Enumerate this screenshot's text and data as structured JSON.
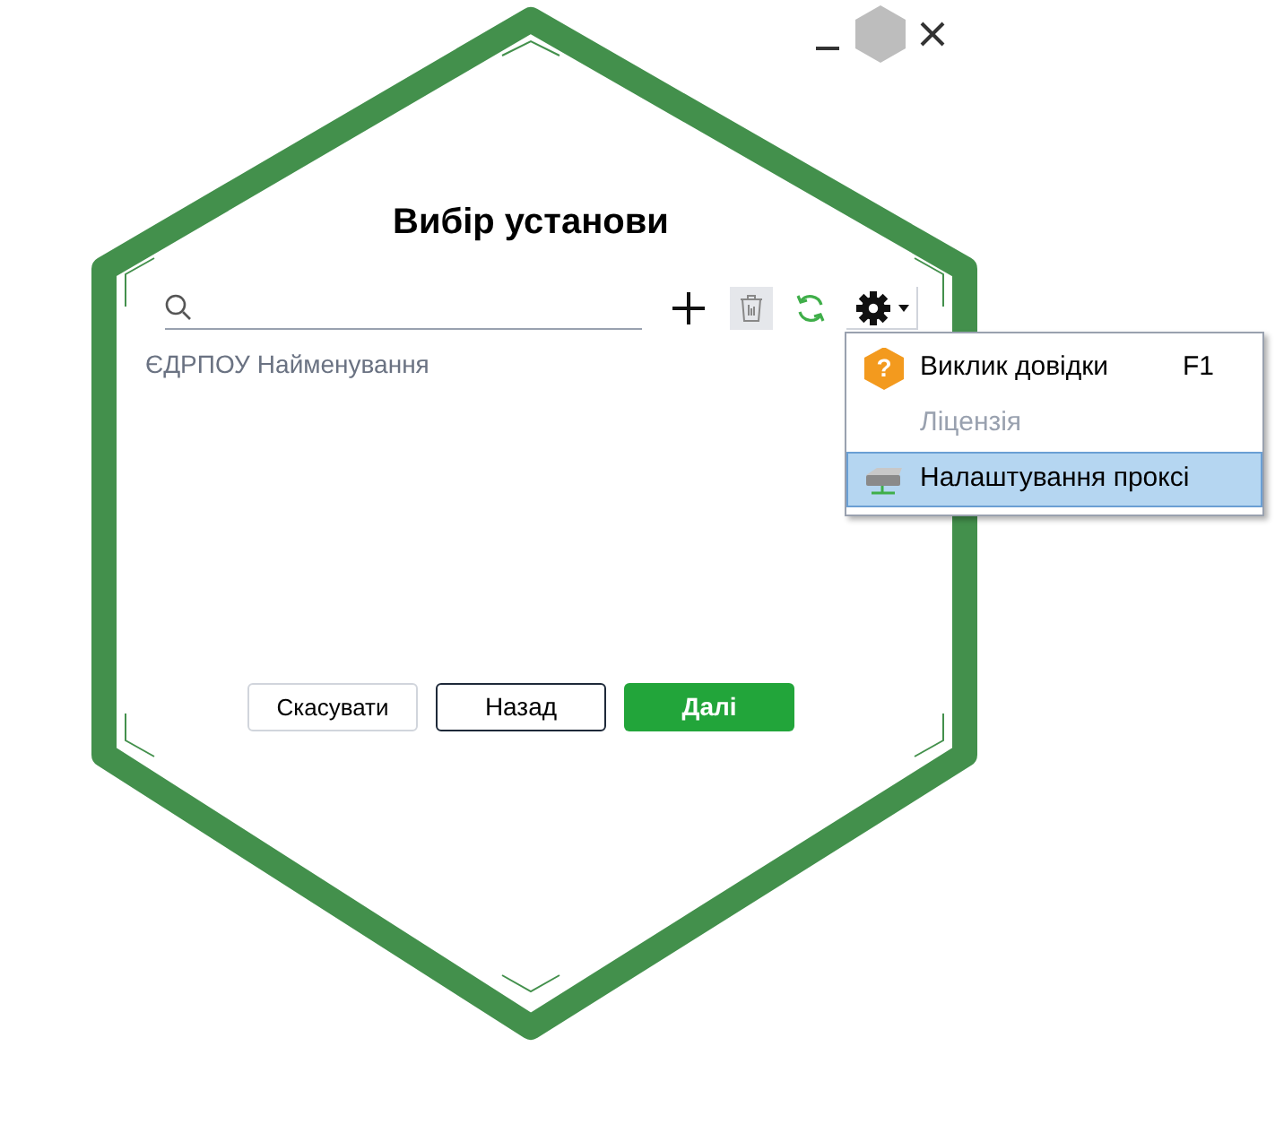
{
  "title": "Вибір установи",
  "columns": [
    "ЄДРПОУ",
    "Найменування"
  ],
  "settings_menu": {
    "expanded": true,
    "items": [
      {
        "kind": "help",
        "icon_text": "?",
        "label": "Виклик довідки",
        "shortcut": "F1",
        "disabled": false,
        "selected": false
      },
      {
        "kind": "plain",
        "label": "Ліцензія",
        "disabled": true,
        "selected": false
      },
      {
        "kind": "proxy",
        "label": "Налаштування проксі",
        "disabled": false,
        "selected": true
      }
    ]
  },
  "buttons": [
    {
      "kind": "secondary",
      "label": "Скасувати"
    },
    {
      "kind": "outline",
      "label": "Назад"
    },
    {
      "kind": "primary",
      "label": "Далі"
    }
  ]
}
